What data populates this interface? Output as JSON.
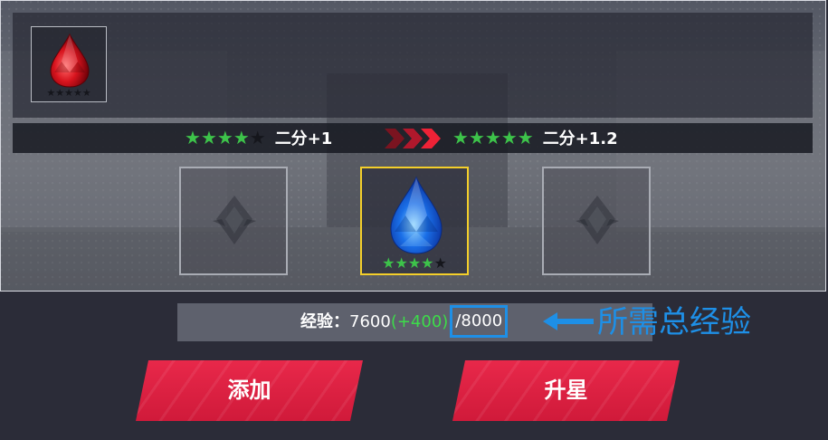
{
  "selected_item": {
    "stars_filled": 0,
    "stars_total": 5,
    "gem_color": "#d8141e"
  },
  "upgrade": {
    "current": {
      "stars_filled": 4,
      "stars_total": 5,
      "stat": "二分+1"
    },
    "next": {
      "stars_filled": 5,
      "stars_total": 5,
      "stat": "二分+1.2"
    }
  },
  "material_slots": [
    {
      "state": "empty",
      "icon": "emblem-icon"
    },
    {
      "state": "filled",
      "gem_color": "#1a6fe8",
      "stars_filled": 4,
      "stars_total": 5
    },
    {
      "state": "empty",
      "icon": "emblem-icon"
    }
  ],
  "exp": {
    "label": "经验：",
    "current": "7600",
    "gain": "(+400)",
    "total": "/8000"
  },
  "annotation": {
    "text": "所需总经验",
    "color": "#1e8fe6"
  },
  "buttons": {
    "add_label": "添加",
    "star_up_label": "升星"
  },
  "colors": {
    "star_on": "#3dc34a",
    "star_off": "#15161c",
    "button": "#d81e3e",
    "highlight": "#f4cf2a"
  }
}
